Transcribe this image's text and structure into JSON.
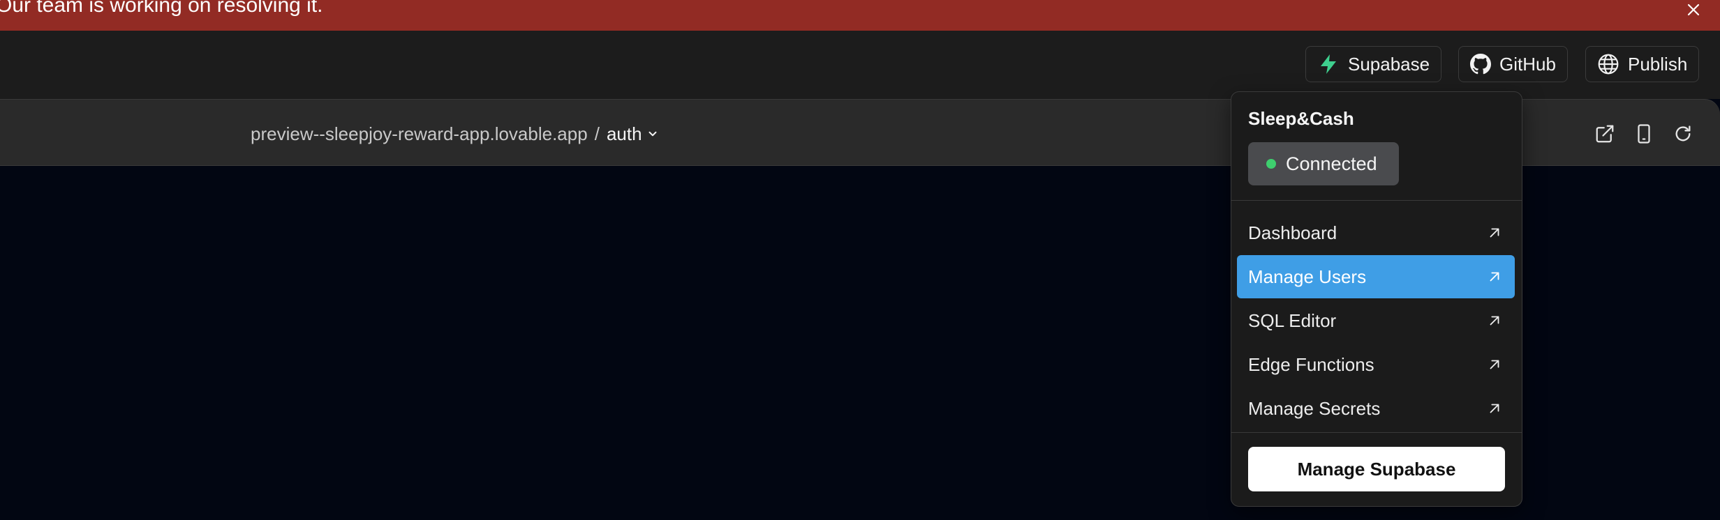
{
  "banner": {
    "text": "Our team is working on resolving it.",
    "close_icon": "close-icon"
  },
  "header": {
    "buttons": [
      {
        "label": "Supabase",
        "icon": "supabase-bolt-icon"
      },
      {
        "label": "GitHub",
        "icon": "github-icon"
      },
      {
        "label": "Publish",
        "icon": "globe-icon"
      }
    ]
  },
  "preview_bar": {
    "host": "preview--sleepjoy-reward-app.lovable.app",
    "separator": "/",
    "route": "auth",
    "route_icon": "chevron-down-icon",
    "tools": [
      "open-external-icon",
      "mobile-device-icon",
      "refresh-icon"
    ]
  },
  "supabase_menu": {
    "project_name": "Sleep&Cash",
    "status": "Connected",
    "status_color": "#3ecf6e",
    "items": [
      {
        "label": "Dashboard",
        "icon": "arrow-up-right-icon",
        "active": false
      },
      {
        "label": "Manage Users",
        "icon": "arrow-up-right-icon",
        "active": true
      },
      {
        "label": "SQL Editor",
        "icon": "arrow-up-right-icon",
        "active": false
      },
      {
        "label": "Edge Functions",
        "icon": "arrow-up-right-icon",
        "active": false
      },
      {
        "label": "Manage Secrets",
        "icon": "arrow-up-right-icon",
        "active": false
      }
    ],
    "primary_button": "Manage Supabase"
  },
  "colors": {
    "banner": "#922b24",
    "topbar": "#1c1c1c",
    "preview_bar": "#2a2a2a",
    "preview_canvas": "#020612",
    "highlight": "#3f9ee6",
    "supabase_green": "#3ecf8e"
  }
}
